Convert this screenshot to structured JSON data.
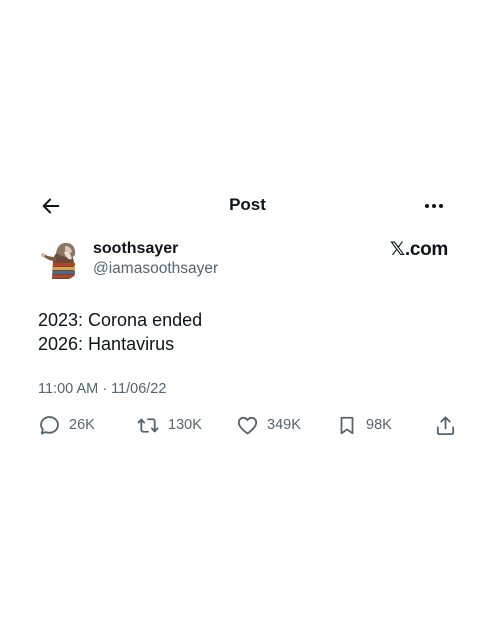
{
  "header": {
    "back_icon": "arrow-left-icon",
    "title": "Post",
    "more_icon": "ellipsis-horizontal-icon"
  },
  "author": {
    "display_name": "soothsayer",
    "handle": "@iamasoothsayer",
    "avatar_icon": "avatar-image"
  },
  "brand": "𝕏.com",
  "tweet": {
    "lines": [
      "2023: Corona ended",
      "2026: Hantavirus"
    ]
  },
  "timestamp": "11:00 AM · 11/06/22",
  "actions": [
    {
      "icon": "reply-icon",
      "count": "26K"
    },
    {
      "icon": "retweet-icon",
      "count": "130K"
    },
    {
      "icon": "heart-icon",
      "count": "349K"
    },
    {
      "icon": "bookmark-icon",
      "count": "98K"
    },
    {
      "icon": "share-icon",
      "count": ""
    }
  ],
  "colors": {
    "text": "#0f1419",
    "secondary": "#536471",
    "background": "#ffffff"
  }
}
